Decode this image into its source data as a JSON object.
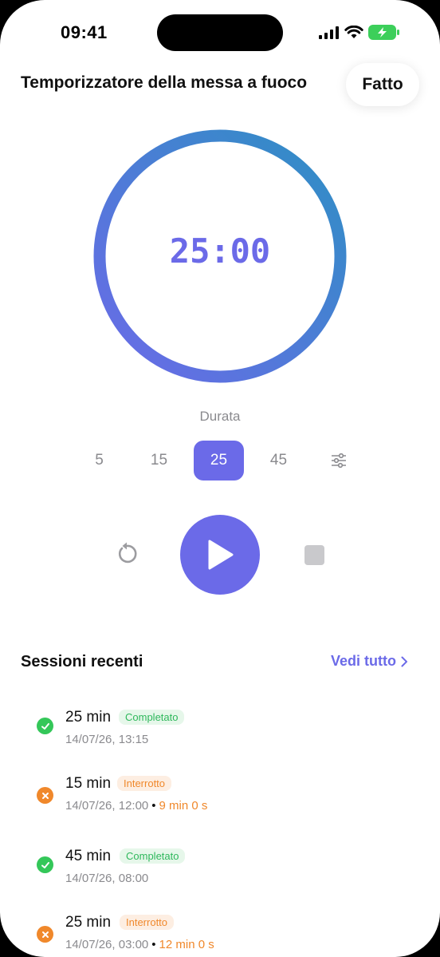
{
  "status_bar": {
    "time": "09:41"
  },
  "header": {
    "title": "Temporizzatore della messa a fuoco",
    "done_label": "Fatto"
  },
  "timer": {
    "display": "25:00"
  },
  "duration": {
    "label": "Durata",
    "options": [
      "5",
      "15",
      "25",
      "45"
    ],
    "selected": "25"
  },
  "controls": {
    "reset": "reset-icon",
    "play": "play-icon",
    "stop": "stop-icon"
  },
  "recent": {
    "title": "Sessioni recenti",
    "see_all": "Vedi tutto",
    "sessions": [
      {
        "duration": "25 min",
        "status": "Completato",
        "date": "14/07/26, 13:15",
        "elapsed": ""
      },
      {
        "duration": "15 min",
        "status": "Interrotto",
        "date": "14/07/26, 12:00",
        "elapsed": "9 min 0 s"
      },
      {
        "duration": "45 min",
        "status": "Completato",
        "date": "14/07/26, 08:00",
        "elapsed": ""
      },
      {
        "duration": "25 min",
        "status": "Interrotto",
        "date": "14/07/26, 03:00",
        "elapsed": "12 min 0 s"
      }
    ]
  },
  "colors": {
    "accent": "#6b6ae8",
    "success": "#2fb85c",
    "warning": "#f0882b",
    "ring_start": "#6b6ae8",
    "ring_end": "#2e8fc4"
  }
}
